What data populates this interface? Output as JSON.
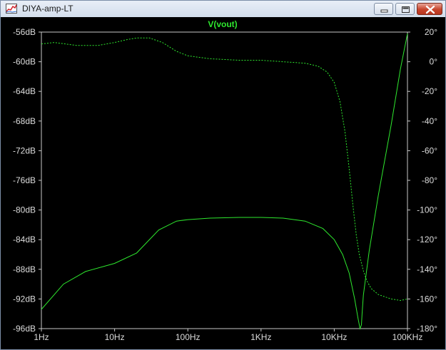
{
  "window": {
    "title": "DIYA-amp-LT",
    "controls": [
      "minimize",
      "maximize",
      "close"
    ]
  },
  "colors": {
    "trace": "#2ee82e",
    "background": "#000000",
    "axis": "#c8c8c8"
  },
  "chart_data": {
    "type": "line",
    "title": "V(vout)",
    "x_scale": "log",
    "xlim": [
      1,
      100000
    ],
    "x_ticks": [
      {
        "value": 1,
        "label": "1Hz"
      },
      {
        "value": 10,
        "label": "10Hz"
      },
      {
        "value": 100,
        "label": "100Hz"
      },
      {
        "value": 1000,
        "label": "1KHz"
      },
      {
        "value": 10000,
        "label": "10KHz"
      },
      {
        "value": 100000,
        "label": "100KHz"
      }
    ],
    "ylim_left": [
      -96,
      -56
    ],
    "y_ticks_left": [
      {
        "value": -56,
        "label": "-56dB"
      },
      {
        "value": -60,
        "label": "-60dB"
      },
      {
        "value": -64,
        "label": "-64dB"
      },
      {
        "value": -68,
        "label": "-68dB"
      },
      {
        "value": -72,
        "label": "-72dB"
      },
      {
        "value": -76,
        "label": "-76dB"
      },
      {
        "value": -80,
        "label": "-80dB"
      },
      {
        "value": -84,
        "label": "-84dB"
      },
      {
        "value": -88,
        "label": "-88dB"
      },
      {
        "value": -92,
        "label": "-92dB"
      },
      {
        "value": -96,
        "label": "-96dB"
      }
    ],
    "ylim_right": [
      -180,
      20
    ],
    "y_ticks_right": [
      {
        "value": 20,
        "label": "20°"
      },
      {
        "value": 0,
        "label": "0°"
      },
      {
        "value": -20,
        "label": "-20°"
      },
      {
        "value": -40,
        "label": "-40°"
      },
      {
        "value": -60,
        "label": "-60°"
      },
      {
        "value": -80,
        "label": "-80°"
      },
      {
        "value": -100,
        "label": "-100°"
      },
      {
        "value": -120,
        "label": "-120°"
      },
      {
        "value": -140,
        "label": "-140°"
      },
      {
        "value": -160,
        "label": "-160°"
      },
      {
        "value": -180,
        "label": "-180°"
      }
    ],
    "grid": false,
    "series": [
      {
        "style": "solid",
        "axis": "left",
        "x": [
          1,
          2,
          4,
          10,
          20,
          40,
          70,
          100,
          200,
          500,
          1000,
          2000,
          4000,
          7000,
          10000,
          13000,
          16000,
          19000,
          21000,
          22500,
          23500,
          24000,
          25000,
          30000,
          40000,
          60000,
          80000,
          100000
        ],
        "y": [
          -93.4,
          -90.0,
          -88.3,
          -87.2,
          -85.8,
          -82.7,
          -81.5,
          -81.3,
          -81.1,
          -81.0,
          -81.0,
          -81.1,
          -81.5,
          -82.5,
          -84.0,
          -86.0,
          -88.5,
          -92.0,
          -94.5,
          -96.0,
          -95.5,
          -94.0,
          -91.5,
          -85.5,
          -78.0,
          -68.5,
          -61.0,
          -56.2
        ]
      },
      {
        "style": "dashed",
        "axis": "right",
        "x": [
          1,
          1.5,
          3,
          6,
          10,
          15,
          20,
          30,
          45,
          70,
          100,
          200,
          500,
          1000,
          2000,
          4000,
          6000,
          8000,
          10000,
          12000,
          14000,
          16000,
          18000,
          20000,
          22000,
          25000,
          28000,
          32000,
          40000,
          60000,
          80000,
          100000
        ],
        "y": [
          12,
          13,
          11,
          11,
          13,
          15,
          16,
          16,
          13,
          7,
          4,
          2,
          1,
          1,
          0,
          -1,
          -3,
          -7,
          -14,
          -27,
          -47,
          -72,
          -97,
          -117,
          -130,
          -141,
          -148,
          -153,
          -157,
          -160,
          -161,
          -160
        ]
      }
    ]
  }
}
